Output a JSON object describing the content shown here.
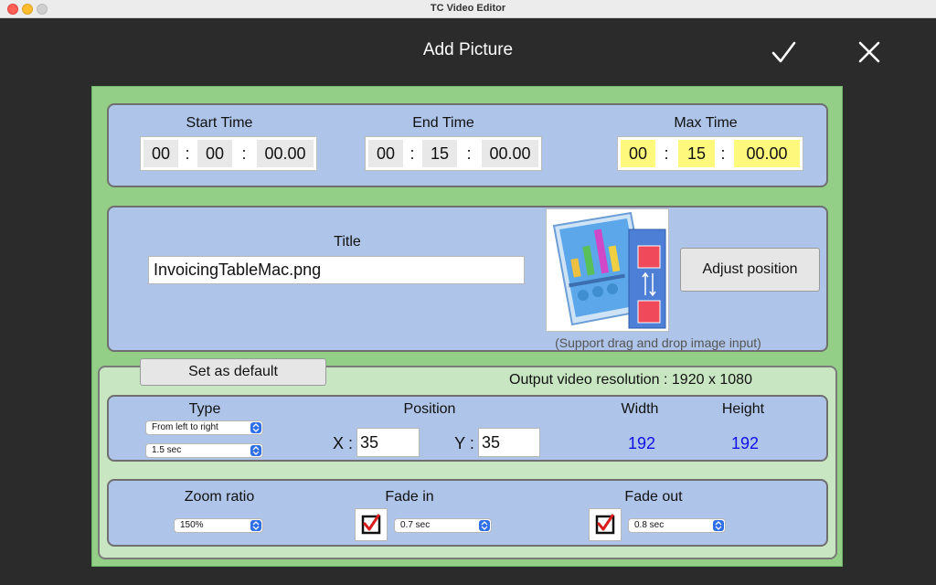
{
  "window": {
    "title": "TC Video Editor"
  },
  "dialog": {
    "title": "Add Picture"
  },
  "times": {
    "start": {
      "label": "Start Time",
      "h": "00",
      "m": "00",
      "s": "00.00"
    },
    "end": {
      "label": "End Time",
      "h": "00",
      "m": "15",
      "s": "00.00"
    },
    "max": {
      "label": "Max Time",
      "h": "00",
      "m": "15",
      "s": "00.00"
    },
    "separator": ":"
  },
  "title_section": {
    "label": "Title",
    "value": "InvoicingTableMac.png",
    "adjust_button": "Adjust position",
    "hint": "(Support drag and drop image input)"
  },
  "settings": {
    "default_button": "Set as default",
    "resolution": "Output video resolution : 1920 x 1080",
    "type": {
      "label": "Type",
      "direction": "From left to right",
      "duration": "1.5 sec"
    },
    "position": {
      "label": "Position",
      "x_label": "X :",
      "x": "35",
      "y_label": "Y :",
      "y": "35"
    },
    "width": {
      "label": "Width",
      "value": "192"
    },
    "height": {
      "label": "Height",
      "value": "192"
    },
    "zoom": {
      "label": "Zoom ratio",
      "value": "150%"
    },
    "fade_in": {
      "label": "Fade in",
      "value": "0.7 sec",
      "checked": true
    },
    "fade_out": {
      "label": "Fade out",
      "value": "0.8 sec",
      "checked": true
    }
  },
  "colors": {
    "panel_green": "#94cf88",
    "box_blue": "#aec4e8",
    "highlight_yellow": "#fef87d",
    "value_blue": "#1010e6"
  }
}
